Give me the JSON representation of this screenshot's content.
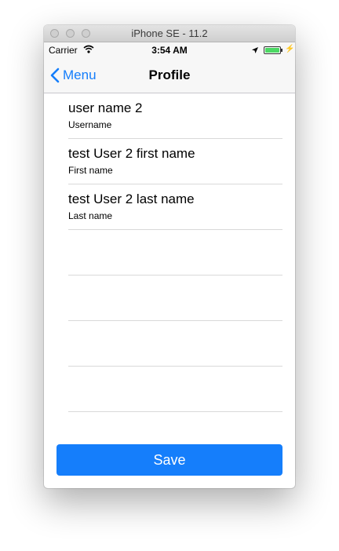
{
  "window": {
    "title": "iPhone SE - 11.2"
  },
  "status_bar": {
    "carrier": "Carrier",
    "time": "3:54 AM",
    "battery_level": 1.0
  },
  "nav": {
    "back_label": "Menu",
    "title": "Profile"
  },
  "fields": [
    {
      "value": "user name 2",
      "label": "Username"
    },
    {
      "value": "test User 2 first name",
      "label": "First name"
    },
    {
      "value": "test User 2 last name",
      "label": "Last name"
    }
  ],
  "empty_rows": 4,
  "save_label": "Save",
  "colors": {
    "accent": "#157efb",
    "battery": "#4cd964"
  },
  "icons": [
    "back-chevron-icon",
    "wifi-icon",
    "location-arrow-icon",
    "battery-icon",
    "charging-bolt-icon"
  ]
}
